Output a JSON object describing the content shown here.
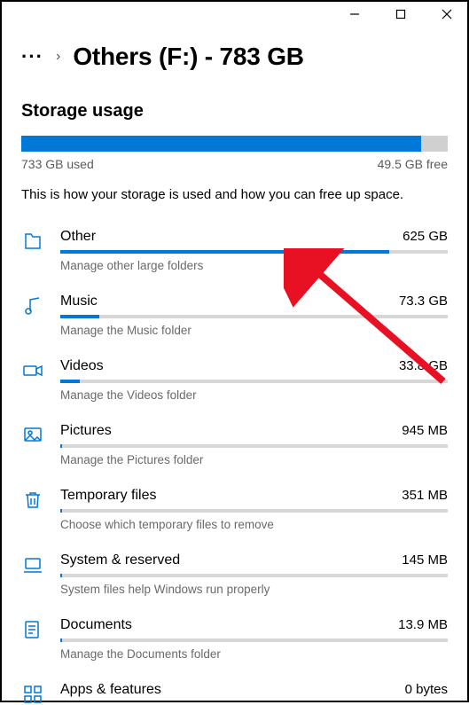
{
  "breadcrumb": {
    "title": "Others (F:) - 783 GB"
  },
  "section": {
    "heading": "Storage usage"
  },
  "total_bar": {
    "used_label": "733 GB used",
    "free_label": "49.5 GB free",
    "fill_percent": 93.7
  },
  "description": "This is how your storage is used and how you can free up space.",
  "categories": [
    {
      "name": "Other",
      "size": "625 GB",
      "sub": "Manage other large folders",
      "fill_percent": 85
    },
    {
      "name": "Music",
      "size": "73.3 GB",
      "sub": "Manage the Music folder",
      "fill_percent": 10
    },
    {
      "name": "Videos",
      "size": "33.8 GB",
      "sub": "Manage the Videos folder",
      "fill_percent": 5
    },
    {
      "name": "Pictures",
      "size": "945 MB",
      "sub": "Manage the Pictures folder",
      "fill_percent": 0.5
    },
    {
      "name": "Temporary files",
      "size": "351 MB",
      "sub": "Choose which temporary files to remove",
      "fill_percent": 0.5
    },
    {
      "name": "System & reserved",
      "size": "145 MB",
      "sub": "System files help Windows run properly",
      "fill_percent": 0.5
    },
    {
      "name": "Documents",
      "size": "13.9 MB",
      "sub": "Manage the Documents folder",
      "fill_percent": 0.5
    },
    {
      "name": "Apps & features",
      "size": "0 bytes",
      "sub": "",
      "fill_percent": 0
    }
  ]
}
